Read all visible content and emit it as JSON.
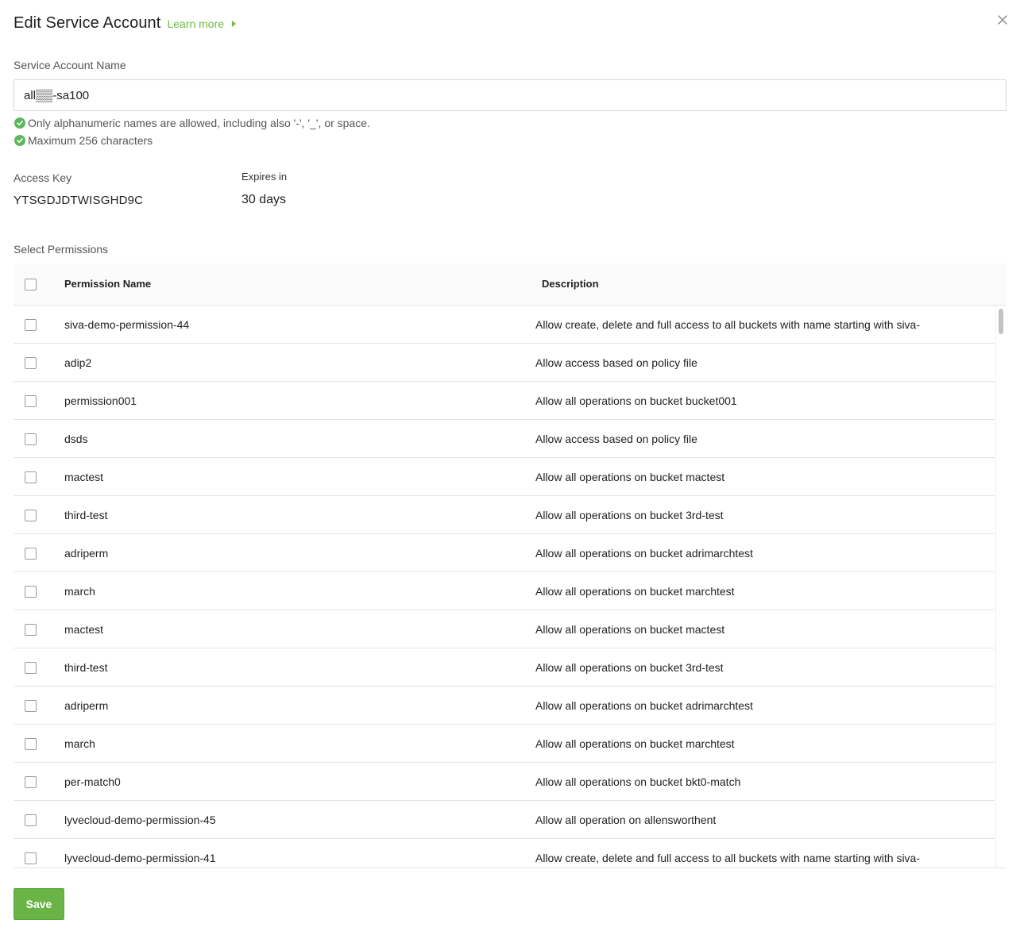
{
  "header": {
    "title": "Edit Service Account",
    "learn_more": "Learn more"
  },
  "name_field": {
    "label": "Service Account Name",
    "value": "all▒▒-sa100"
  },
  "hints": [
    "Only alphanumeric names are allowed, including also '-', '_', or space.",
    "Maximum 256 characters"
  ],
  "access_key": {
    "label": "Access Key",
    "value": "YTSGDJDTWISGHD9C"
  },
  "expires": {
    "label": "Expires in",
    "value": "30 days"
  },
  "permissions": {
    "label": "Select Permissions",
    "columns": [
      "Permission Name",
      "Description"
    ],
    "rows": [
      {
        "name": "siva-demo-permission-44",
        "description": "Allow create, delete and full access to all buckets with name starting with siva-"
      },
      {
        "name": "adip2",
        "description": "Allow access based on policy file"
      },
      {
        "name": "permission001",
        "description": "Allow all operations on bucket bucket001"
      },
      {
        "name": "dsds",
        "description": "Allow access based on policy file"
      },
      {
        "name": "mactest",
        "description": "Allow all operations on bucket mactest"
      },
      {
        "name": "third-test",
        "description": "Allow all operations on bucket 3rd-test"
      },
      {
        "name": "adriperm",
        "description": "Allow all operations on bucket adrimarchtest"
      },
      {
        "name": "march",
        "description": "Allow all operations on bucket marchtest"
      },
      {
        "name": "mactest",
        "description": "Allow all operations on bucket mactest"
      },
      {
        "name": "third-test",
        "description": "Allow all operations on bucket 3rd-test"
      },
      {
        "name": "adriperm",
        "description": "Allow all operations on bucket adrimarchtest"
      },
      {
        "name": "march",
        "description": "Allow all operations on bucket marchtest"
      },
      {
        "name": "per-match0",
        "description": "Allow all operations on bucket bkt0-match"
      },
      {
        "name": "lyvecloud-demo-permission-45",
        "description": "Allow all operation on allensworthent"
      },
      {
        "name": "lyvecloud-demo-permission-41",
        "description": "Allow create, delete and full access to all buckets with name starting with siva-"
      }
    ]
  },
  "footer": {
    "save_label": "Save"
  },
  "colors": {
    "accent": "#6ebd44",
    "button": "#6ab446",
    "check": "#5cb85c"
  },
  "icons": {
    "close": "close-icon",
    "learn_more": "caret-right-icon",
    "hint": "check-circle-icon"
  }
}
